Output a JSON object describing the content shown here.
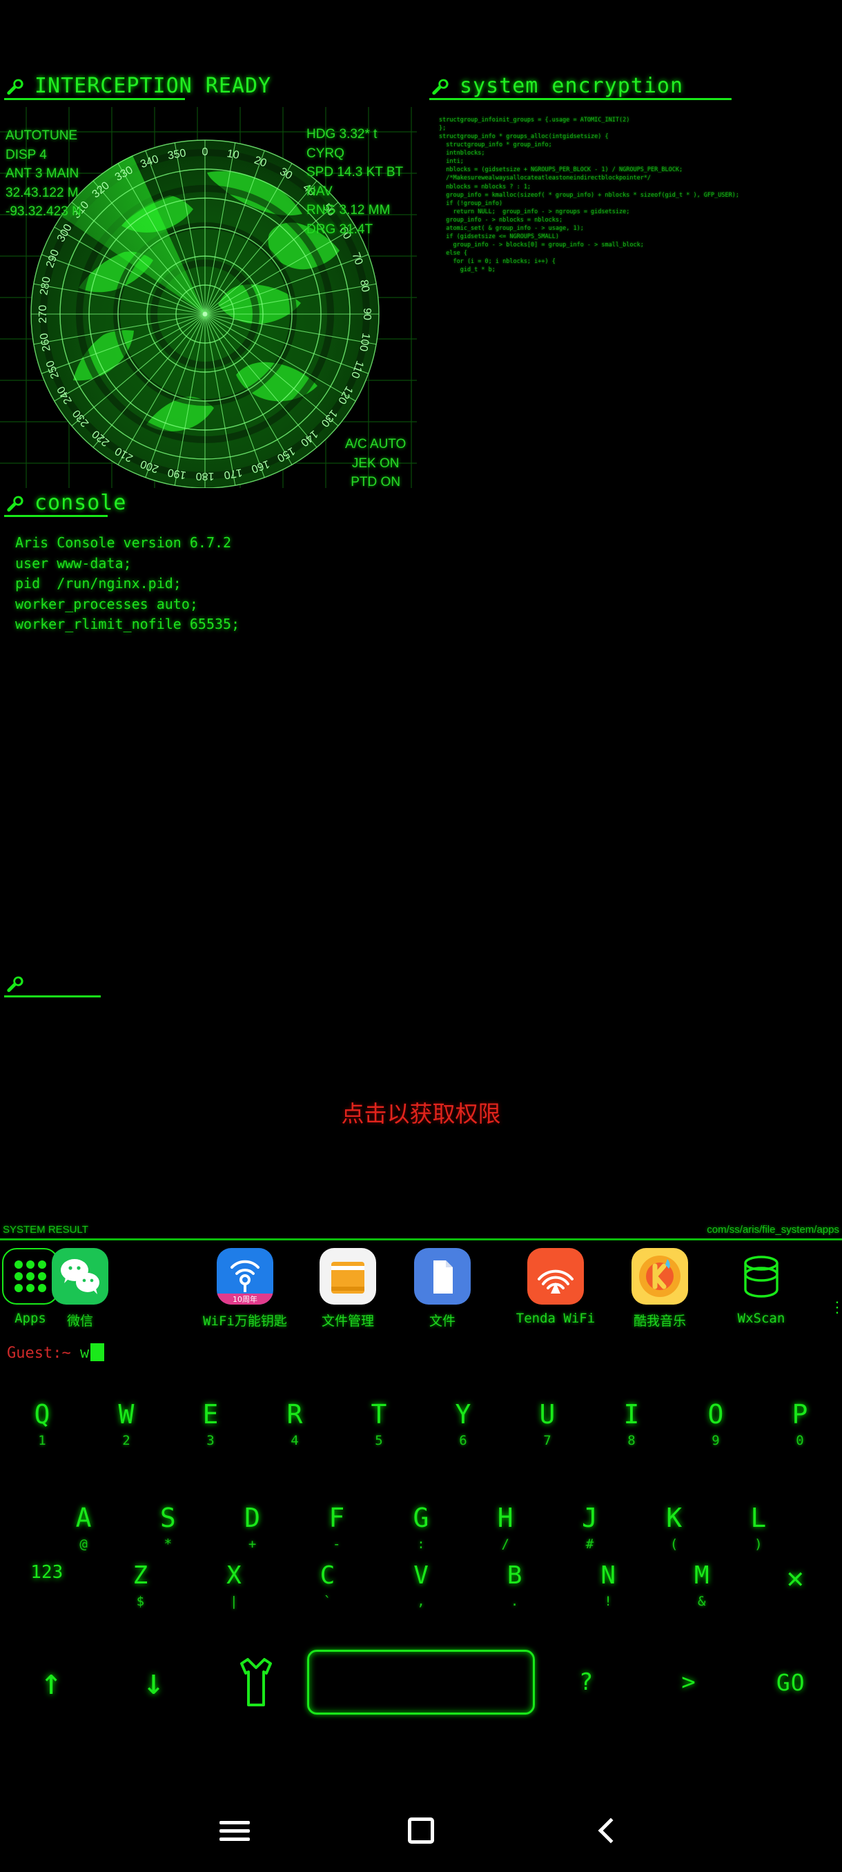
{
  "panels": {
    "radar": {
      "title": "INTERCEPTION READY",
      "icon": "wrench-icon"
    },
    "encryption": {
      "title": "system encryption",
      "icon": "wrench-icon"
    },
    "console": {
      "title": "console",
      "icon": "wrench-icon"
    },
    "empty": {
      "title": "",
      "icon": "wrench-icon"
    }
  },
  "radar": {
    "left_readout": "AUTOTUNE\nDISP 4\nANT 3 MAIN\n32.43.122 M\n-93.32.423 N",
    "right_readout": "HDG 3.32* t CYRQ\nSPD 14.3 KT BT NAV\nRNG 3.12 MM\nDRG 31.4T",
    "corner_readout": "A/C AUTO\nJEK ON\nPTD ON",
    "bearing_labels": [
      "0",
      "10",
      "20",
      "30",
      "40",
      "50",
      "60",
      "70",
      "80",
      "90",
      "100",
      "110",
      "120",
      "130",
      "140",
      "150",
      "160",
      "170",
      "180",
      "190",
      "200",
      "210",
      "220",
      "230",
      "240",
      "250",
      "260",
      "270",
      "280",
      "290",
      "300",
      "310",
      "320",
      "330",
      "340",
      "350"
    ],
    "sweep_start_deg": 305,
    "sweep_end_deg": 340
  },
  "code": "structgroup_infoinit_groups = {.usage = ATOMIC_INIT(2)\n};\nstructgroup_info * groups_alloc(intgidsetsize) {\n  structgroup_info * group_info;\n  intnblocks;\n  inti;\n  nblocks = (gidsetsize + NGROUPS_PER_BLOCK - 1) / NGROUPS_PER_BLOCK;\n  /*Makesurewealwaysallocateatleastoneindirectblockpointer*/\n  nblocks = nblocks ? : 1;\n  group_info = kmalloc(sizeof( * group_info) + nblocks * sizeof(gid_t * ), GFP_USER);\n  if (!group_info)\n    return NULL;  group_info - > ngroups = gidsetsize;\n  group_info - > nblocks = nblocks;\n  atomic_set( & group_info - > usage, 1);\n  if (gidsetsize <= NGROUPS_SMALL)\n    group_info - > blocks[0] = group_info - > small_block;\n  else {\n    for (i = 0; i nblocks; i++) {\n      gid_t * b;",
  "console": {
    "lines": "Aris Console version 6.7.2\nuser www-data;\npid  /run/nginx.pid;\nworker_processes auto;\nworker_rlimit_nofile 65535;"
  },
  "permission_prompt": "点击以获取权限",
  "system_bar": {
    "left": "SYSTEM RESULT",
    "right": "com/ss/aris/file_system/apps"
  },
  "dock": {
    "apps": [
      {
        "label": "Apps",
        "icon": "apps-grid-icon"
      },
      {
        "label": "微信",
        "icon": "wechat-icon"
      },
      {
        "label": "WiFi万能钥匙",
        "icon": "wifi-master-key-icon"
      },
      {
        "label": "文件管理",
        "icon": "file-manager-icon"
      },
      {
        "label": "文件",
        "icon": "files-icon"
      },
      {
        "label": "Tenda WiFi",
        "icon": "tenda-wifi-icon"
      },
      {
        "label": "酷我音乐",
        "icon": "kuwo-music-icon"
      },
      {
        "label": "WxScan",
        "icon": "database-icon"
      }
    ],
    "overflow": "⋮",
    "wifi_master_badge": "10周年"
  },
  "prompt": {
    "user": "Guest:~",
    "typed": "w"
  },
  "keyboard": {
    "row1": [
      {
        "main": "Q",
        "sub": "1"
      },
      {
        "main": "W",
        "sub": "2"
      },
      {
        "main": "E",
        "sub": "3"
      },
      {
        "main": "R",
        "sub": "4"
      },
      {
        "main": "T",
        "sub": "5"
      },
      {
        "main": "Y",
        "sub": "6"
      },
      {
        "main": "U",
        "sub": "7"
      },
      {
        "main": "I",
        "sub": "8"
      },
      {
        "main": "O",
        "sub": "9"
      },
      {
        "main": "P",
        "sub": "0"
      }
    ],
    "row2": [
      {
        "main": "A",
        "sub": "@"
      },
      {
        "main": "S",
        "sub": "*"
      },
      {
        "main": "D",
        "sub": "+"
      },
      {
        "main": "F",
        "sub": "-"
      },
      {
        "main": "G",
        "sub": ":"
      },
      {
        "main": "H",
        "sub": "/"
      },
      {
        "main": "J",
        "sub": "#"
      },
      {
        "main": "K",
        "sub": "("
      },
      {
        "main": "L",
        "sub": ")"
      }
    ],
    "row3": [
      {
        "main": "123",
        "sub": ""
      },
      {
        "main": "Z",
        "sub": "$"
      },
      {
        "main": "X",
        "sub": "|"
      },
      {
        "main": "C",
        "sub": "`"
      },
      {
        "main": "V",
        "sub": ","
      },
      {
        "main": "B",
        "sub": "."
      },
      {
        "main": "N",
        "sub": "!"
      },
      {
        "main": "M",
        "sub": "&"
      },
      {
        "main": "✕",
        "sub": ""
      }
    ],
    "row4": {
      "up": "↑",
      "down": "↓",
      "shirt_icon": "shirt-icon",
      "space": "",
      "question": "?",
      "greater": ">",
      "go": "GO"
    }
  },
  "navbar": {
    "menu": "menu-icon",
    "home": "home-icon",
    "back": "back-icon"
  },
  "colors": {
    "green": "#18e818",
    "red": "#e0241c",
    "bg": "#000000"
  }
}
